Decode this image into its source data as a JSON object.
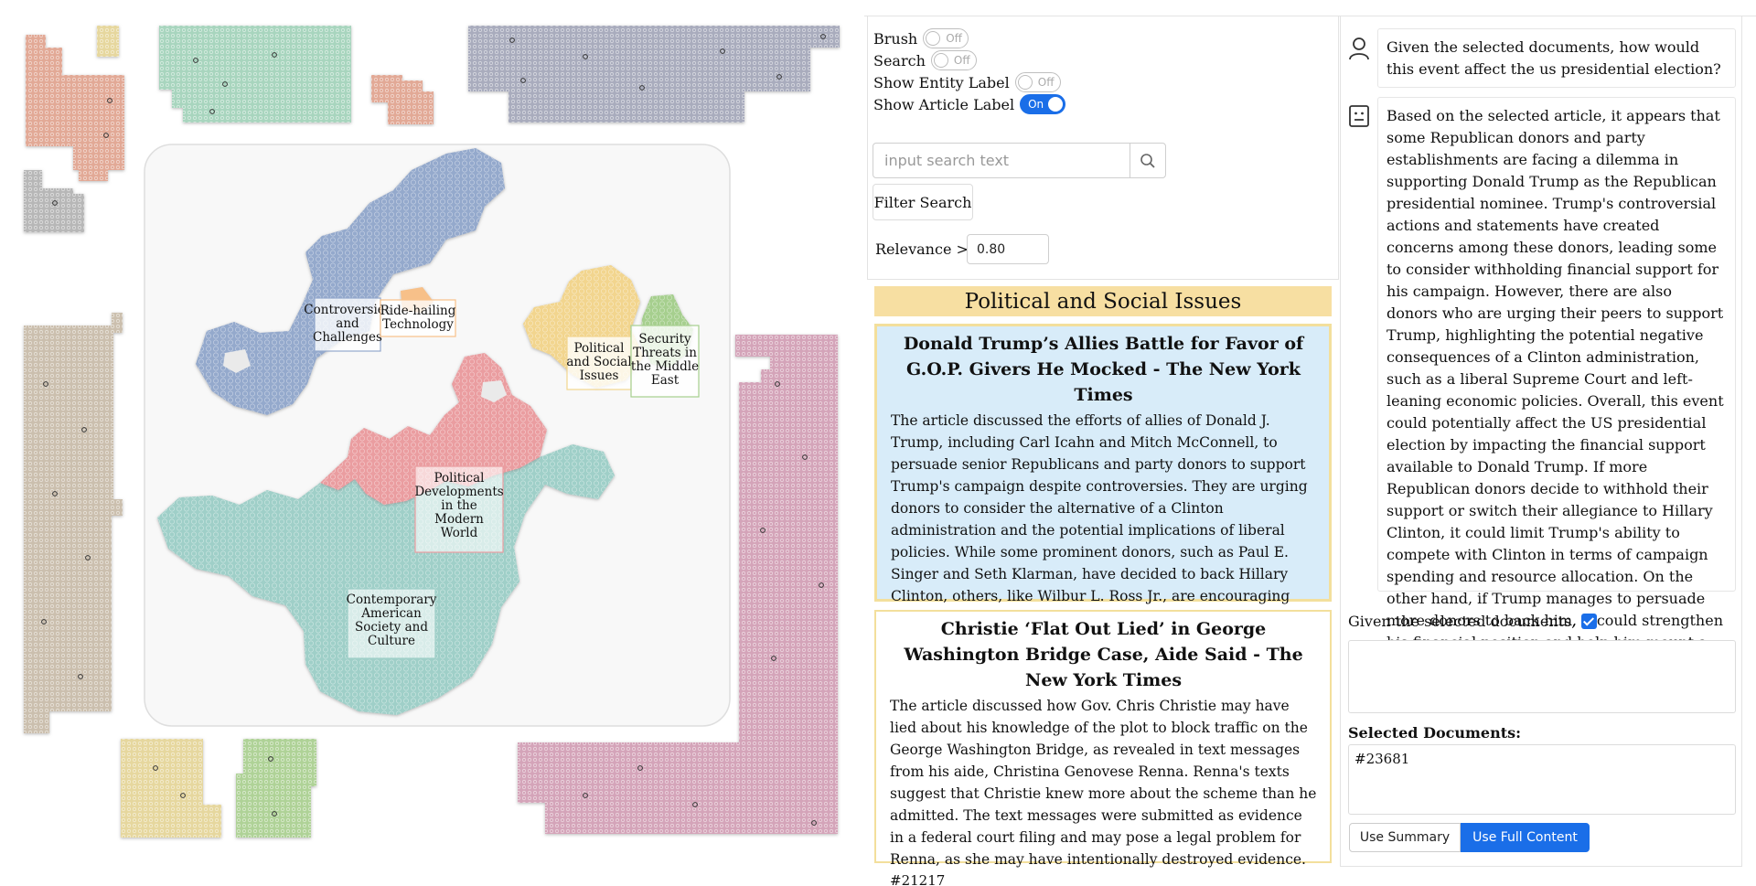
{
  "controls": {
    "brush_label": "Brush",
    "brush_state": "Off",
    "search_label": "Search",
    "search_state": "Off",
    "entity_label": "Show Entity Label",
    "entity_state": "Off",
    "article_label": "Show Article Label",
    "article_state": "On",
    "search_placeholder": "input search text",
    "filter_button": "Filter Search",
    "relevance_label": "Relevance >=",
    "relevance_value": "0.80"
  },
  "map": {
    "topic_labels": [
      "Controversies and Challenges",
      "Ride-hailing Technology",
      "Political and Social Issues",
      "Security Threats in the Middle East",
      "Political Developments in the Modern World",
      "Contemporary American Society and Culture"
    ],
    "colors": {
      "blue": "#94a9cc",
      "teal": "#9fcfc8",
      "red": "#ea9da0",
      "yellow": "#f2d58e",
      "green": "#a6cf8e",
      "orange": "#f7c089",
      "salmon": "#e2a996",
      "mint": "#a8d5be",
      "slate": "#a9acbd",
      "beige": "#cbbfae",
      "pink": "#d4a4b9",
      "gray": "#b7b7b7"
    }
  },
  "docs": {
    "topic_header": "Political and Social Issues",
    "items": [
      {
        "title": "Donald Trump’s Allies Battle for Favor of G.O.P. Givers He Mocked - The New York Times",
        "body": "The article discussed the efforts of allies of Donald J. Trump, including Carl Icahn and Mitch McConnell, to persuade senior Republicans and party donors to support Trump's campaign despite controversies. They are urging donors to consider the alternative of a Clinton administration and the potential implications of liberal policies. While some prominent donors, such as Paul E. Singer and Seth Klarman, have decided to back Hillary Clinton, others, like Wilbur L. Ross Jr., are encouraging their peers to support Trump.",
        "id": "#23681"
      },
      {
        "title": "Christie ‘Flat Out Lied’ in George Washington Bridge Case, Aide Said - The New York Times",
        "body": "The article discussed how Gov. Chris Christie may have lied about his knowledge of the plot to block traffic on the George Washington Bridge, as revealed in text messages from his aide, Christina Genovese Renna. Renna's texts suggest that Christie knew more about the scheme than he admitted. The text messages were submitted as evidence in a federal court filing and may pose a legal problem for Renna, as she may have intentionally destroyed evidence.",
        "id": "#21217"
      }
    ]
  },
  "chat": {
    "question": "Given the selected documents, how would this event affect the us presidential election?",
    "answer": "Based on the selected article, it appears that some Republican donors and party establishments are facing a dilemma in supporting Donald Trump as the Republican presidential nominee. Trump's controversial actions and statements have created concerns among these donors, leading some to consider withholding financial support for his campaign. However, there are also donors who are urging their peers to support Trump, highlighting the potential negative consequences of a Clinton administration, such as a liberal Supreme Court and left-leaning economic policies. Overall, this event could potentially affect the US presidential election by impacting the financial support available to Donald Trump. If more Republican donors decide to withhold their support or switch their allegiance to Hillary Clinton, it could limit Trump's ability to compete with Clinton in terms of campaign spending and resource allocation. On the other hand, if Trump manages to persuade more donors to back him, it could strengthen his financial position and help him mount a more robust campaign against Clinton.",
    "given_label": "Given the selected documents,",
    "selected_label": "Selected Documents:",
    "selected_docs": "#23681",
    "use_summary": "Use Summary",
    "use_full": "Use Full Content"
  },
  "icons": {
    "user": "user-icon",
    "bot": "robot-icon",
    "search": "search-icon"
  }
}
